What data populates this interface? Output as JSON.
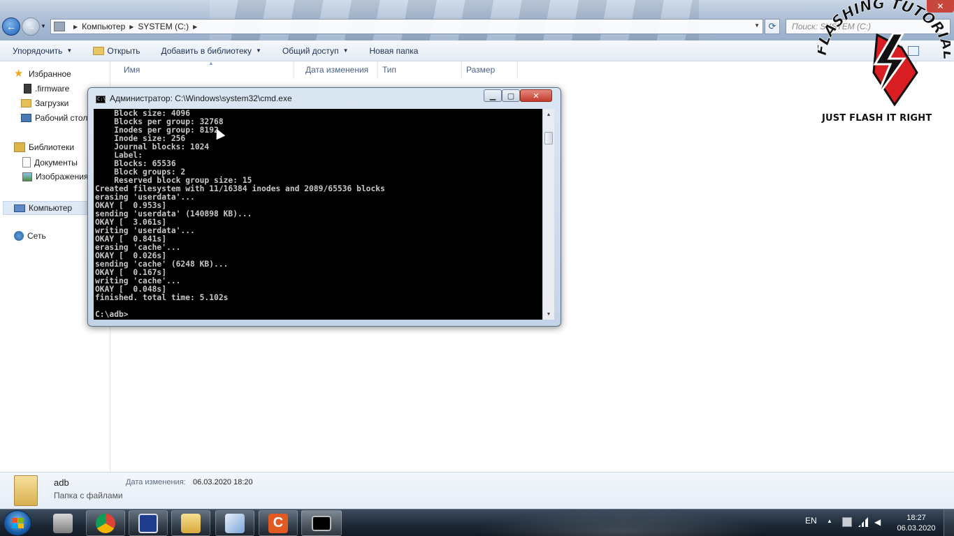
{
  "explorer": {
    "breadcrumb": [
      "Компьютер",
      "SYSTEM (C:)"
    ],
    "search_placeholder": "Поиск: SYSTEM (C:)",
    "toolbar": {
      "organize": "Упорядочить",
      "open": "Открыть",
      "add_to_library": "Добавить в библиотеку",
      "share": "Общий доступ",
      "new_folder": "Новая папка"
    },
    "nav": {
      "favorites": "Избранное",
      "firmware": ".firmware",
      "downloads": "Загрузки",
      "desktop": "Рабочий стол",
      "libraries": "Библиотеки",
      "documents": "Документы",
      "pictures": "Изображения",
      "computer": "Компьютер",
      "network": "Сеть"
    },
    "columns": {
      "name": "Имя",
      "date_modified": "Дата изменения",
      "type": "Тип",
      "size": "Размер"
    },
    "details": {
      "name": "adb",
      "type": "Папка с файлами",
      "date_label": "Дата изменения:",
      "date_value": "06.03.2020 18:20"
    }
  },
  "cmd": {
    "title": "Администратор: C:\\Windows\\system32\\cmd.exe",
    "lines": [
      "    Block size: 4096",
      "    Blocks per group: 32768",
      "    Inodes per group: 8192",
      "    Inode size: 256",
      "    Journal blocks: 1024",
      "    Label:",
      "    Blocks: 65536",
      "    Block groups: 2",
      "    Reserved block group size: 15",
      "Created filesystem with 11/16384 inodes and 2089/65536 blocks",
      "erasing 'userdata'...",
      "OKAY [  0.953s]",
      "sending 'userdata' (140898 KB)...",
      "OKAY [  3.061s]",
      "writing 'userdata'...",
      "OKAY [  0.841s]",
      "erasing 'cache'...",
      "OKAY [  0.026s]",
      "sending 'cache' (6248 KB)...",
      "OKAY [  0.167s]",
      "writing 'cache'...",
      "OKAY [  0.048s]",
      "finished. total time: 5.102s",
      "",
      "C:\\adb>"
    ]
  },
  "watermark": {
    "brand": "FLASHING TUTORIALS",
    "tagline": "JUST FLASH IT RIGHT"
  },
  "taskbar": {
    "apps": [
      "printer-icon",
      "chrome-icon",
      "floppy-icon",
      "explorer-icon",
      "paint-icon",
      "app-c-icon",
      "cmd-icon"
    ],
    "language": "EN",
    "time": "18:27",
    "date": "06.03.2020"
  },
  "colors": {
    "console_bg": "#000000",
    "console_text": "#c8c8c8",
    "logo_red": "#d81e23"
  }
}
